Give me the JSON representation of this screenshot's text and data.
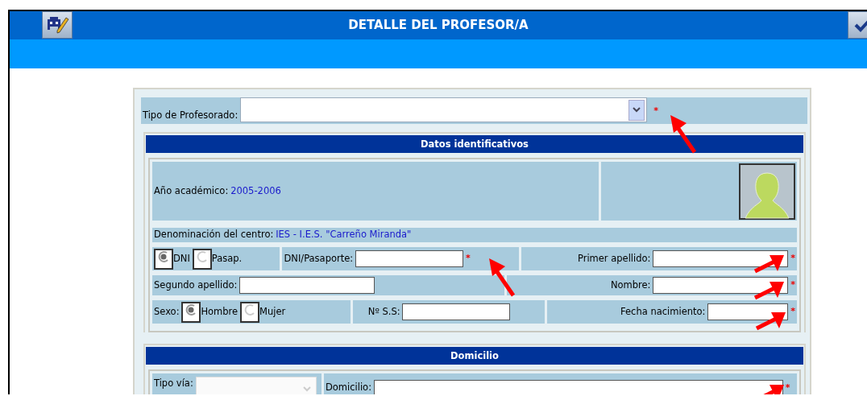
{
  "window": {
    "title": "DETALLE DEL PROFESOR/A"
  },
  "tipo_profesorado": {
    "label": "Tipo de Profesorado:",
    "required": "*",
    "arrow": {
      "kind": "up-left"
    }
  },
  "datos": {
    "title": "Datos identificativos",
    "anio": {
      "label": "Año académico:",
      "value": "2005-2006"
    },
    "centro": {
      "label": "Denominación del centro:",
      "value": "IES - I.E.S. \"Carreño Miranda\""
    },
    "doc_type": [
      {
        "label": "DNI",
        "selected": true
      },
      {
        "label": "Pasap.",
        "selected": false
      }
    ],
    "dni": {
      "label": "DNI/Pasaporte:",
      "required": "*",
      "arrow": {
        "kind": "up-left"
      }
    },
    "primer_apellido": {
      "label": "Primer apellido:",
      "required": "*",
      "arrow": {
        "kind": "up-right"
      }
    },
    "segundo_apellido": {
      "label": "Segundo apellido:"
    },
    "nombre": {
      "label": "Nombre:",
      "required": "*",
      "arrow": {
        "kind": "up-right"
      }
    },
    "sexo": {
      "label": "Sexo:",
      "options": [
        {
          "label": "Hombre",
          "selected": true
        },
        {
          "label": "Mujer",
          "selected": false
        }
      ]
    },
    "nss": {
      "label": "Nº S.S:"
    },
    "fecha": {
      "label": "Fecha nacimiento:",
      "required": "*",
      "arrow": {
        "kind": "up-right"
      }
    }
  },
  "domicilio": {
    "title": "Domicilio",
    "tipo_via": {
      "label": "Tipo vía:",
      "disabled": true
    },
    "domicilio": {
      "label": "Domicilio:",
      "required": "*",
      "arrow": {
        "kind": "up-right"
      }
    }
  }
}
